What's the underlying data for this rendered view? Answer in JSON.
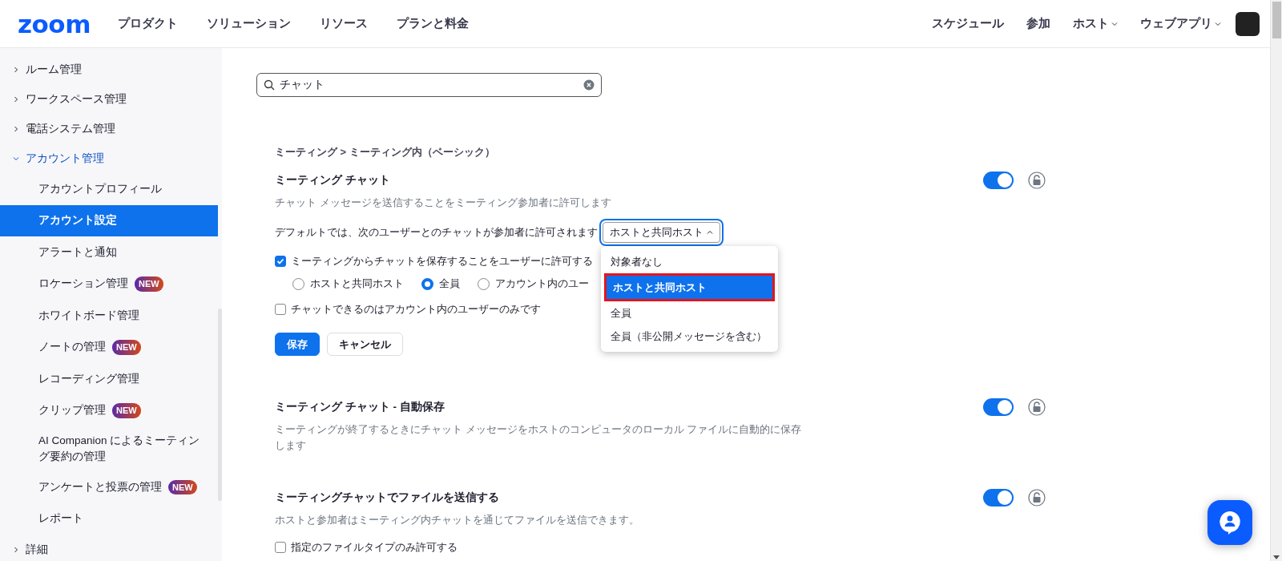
{
  "header": {
    "logo": "zoom",
    "nav": [
      "プロダクト",
      "ソリューション",
      "リソース",
      "プランと料金"
    ],
    "right_nav": [
      {
        "label": "スケジュール",
        "dropdown": false
      },
      {
        "label": "参加",
        "dropdown": false
      },
      {
        "label": "ホスト",
        "dropdown": true
      },
      {
        "label": "ウェブアプリ",
        "dropdown": true
      }
    ]
  },
  "sidebar": {
    "items": [
      {
        "label": "ルーム管理",
        "expanded": false
      },
      {
        "label": "ワークスペース管理",
        "expanded": false
      },
      {
        "label": "電話システム管理",
        "expanded": false
      },
      {
        "label": "アカウント管理",
        "expanded": true,
        "children": [
          {
            "label": "アカウントプロフィール",
            "selected": false
          },
          {
            "label": "アカウント設定",
            "selected": true
          },
          {
            "label": "アラートと通知",
            "selected": false
          },
          {
            "label": "ロケーション管理",
            "selected": false,
            "badge": "NEW"
          },
          {
            "label": "ホワイトボード管理",
            "selected": false
          },
          {
            "label": "ノートの管理",
            "selected": false,
            "badge": "NEW"
          },
          {
            "label": "レコーディング管理",
            "selected": false
          },
          {
            "label": "クリップ管理",
            "selected": false,
            "badge": "NEW"
          },
          {
            "label": "AI Companion によるミーティング要約の管理",
            "selected": false
          },
          {
            "label": "アンケートと投票の管理",
            "selected": false,
            "badge": "NEW"
          },
          {
            "label": "レポート",
            "selected": false
          }
        ]
      },
      {
        "label": "詳細",
        "expanded": false
      }
    ]
  },
  "search": {
    "value": "チャット"
  },
  "breadcrumb": "ミーティング > ミーティング内（ベーシック）",
  "settings": [
    {
      "title": "ミーティング チャット",
      "description": "チャット メッセージを送信することをミーティング参加者に許可します",
      "on": true,
      "locked": false,
      "default_select": {
        "label": "デフォルトでは、次のユーザーとのチャットが参加者に許可されます",
        "value": "ホストと共同ホスト",
        "expanded": true,
        "options": [
          {
            "label": "対象者なし",
            "selected": false
          },
          {
            "label": "ホストと共同ホスト",
            "selected": true
          },
          {
            "label": "全員",
            "selected": false
          },
          {
            "label": "全員（非公開メッセージを含む）",
            "selected": false
          }
        ]
      },
      "controls": [
        {
          "kind": "checkbox",
          "label": "ミーティングからチャットを保存することをユーザーに許可する",
          "checked": true
        },
        {
          "kind": "radios",
          "options": [
            {
              "label": "ホストと共同ホスト",
              "selected": false
            },
            {
              "label": "全員",
              "selected": true
            },
            {
              "label": "アカウント内のユー",
              "selected": false
            }
          ]
        },
        {
          "kind": "checkbox",
          "label": "チャットできるのはアカウント内のユーザーのみです",
          "checked": false
        }
      ],
      "buttons": [
        {
          "label": "保存",
          "kind": "primary"
        },
        {
          "label": "キャンセル",
          "kind": "secondary"
        }
      ]
    },
    {
      "title": "ミーティング チャット - 自動保存",
      "description": "ミーティングが終了するときにチャット メッセージをホストのコンピュータのローカル ファイルに自動的に保存します",
      "on": true,
      "locked": false
    },
    {
      "title": "ミーティングチャットでファイルを送信する",
      "description": "ホストと参加者はミーティング内チャットを通じてファイルを送信できます。",
      "on": true,
      "locked": false,
      "controls": [
        {
          "kind": "checkbox",
          "label": "指定のファイルタイプのみ許可する",
          "checked": false
        }
      ]
    }
  ]
}
